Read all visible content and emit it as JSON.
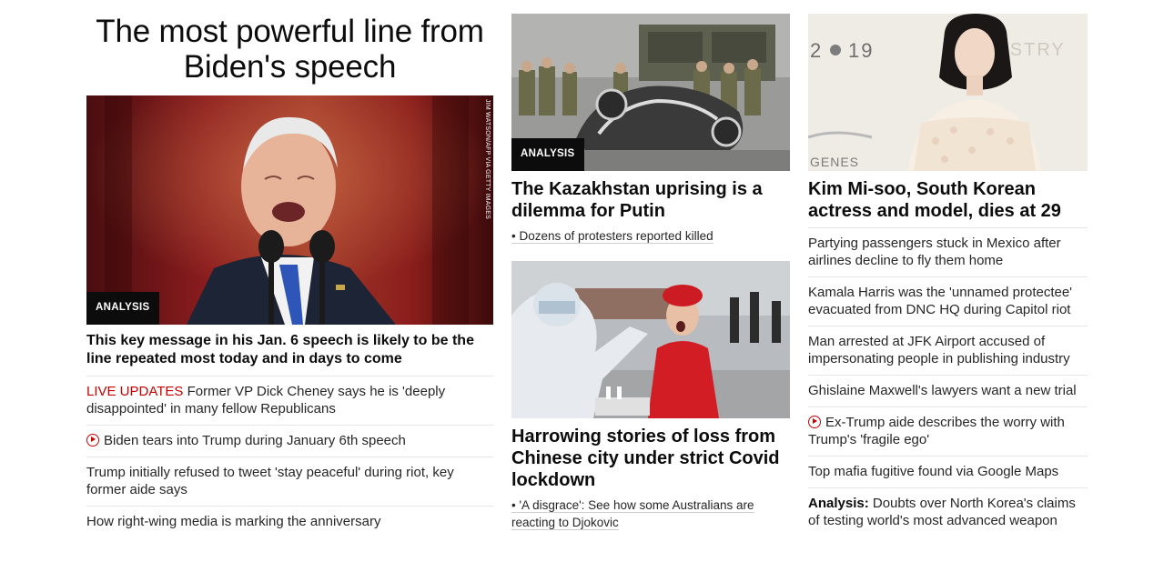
{
  "left": {
    "headline": "The most powerful line from Biden's speech",
    "badge": "ANALYSIS",
    "credit": "JIM WATSON/AFP VIA GETTY IMAGES",
    "lead_title": "This key message in his Jan. 6 speech is likely to be the line repeated most today and in days to come",
    "items": [
      {
        "prefix": "LIVE UPDATES",
        "text": " Former VP Dick Cheney says he is 'deeply disappointed' in many fellow Republicans"
      },
      {
        "text": "Biden tears into Trump during January 6th speech"
      },
      {
        "text": "Trump initially refused to tweet 'stay peaceful' during riot, key former aide says"
      },
      {
        "text": "How right-wing media is marking the anniversary"
      }
    ]
  },
  "middle": {
    "card1": {
      "badge": "ANALYSIS",
      "title": "The Kazakhstan uprising is a dilemma for Putin",
      "sub": "• Dozens of protesters reported killed"
    },
    "card2": {
      "title": "Harrowing stories of loss from Chinese city under strict Covid lockdown",
      "sub": "• 'A disgrace': See how some Australians are reacting to Djokovic"
    }
  },
  "right": {
    "image_text_left": "2",
    "image_text_year": "19",
    "image_text_right": "TISTRY",
    "image_text_bottom": "GENES",
    "title": "Kim Mi-soo, South Korean actress and model, dies at 29",
    "items": [
      {
        "text": "Partying passengers stuck in Mexico after airlines decline to fly them home"
      },
      {
        "text": "Kamala Harris was the 'unnamed protectee' evacuated from DNC HQ during Capitol riot"
      },
      {
        "text": "Man arrested at JFK Airport accused of impersonating people in publishing industry"
      },
      {
        "text": "Ghislaine Maxwell's lawyers want a new trial"
      },
      {
        "text": "Ex-Trump aide describes the worry with Trump's 'fragile ego'"
      },
      {
        "text": "Top mafia fugitive found via Google Maps"
      },
      {
        "prefix": "Analysis:",
        "text": " Doubts over North Korea's claims of testing world's most advanced weapon"
      }
    ]
  },
  "colors": {
    "live_red": "#cc0000",
    "badge_bg": "#0c0c0c",
    "divider": "#e6e6e6"
  }
}
